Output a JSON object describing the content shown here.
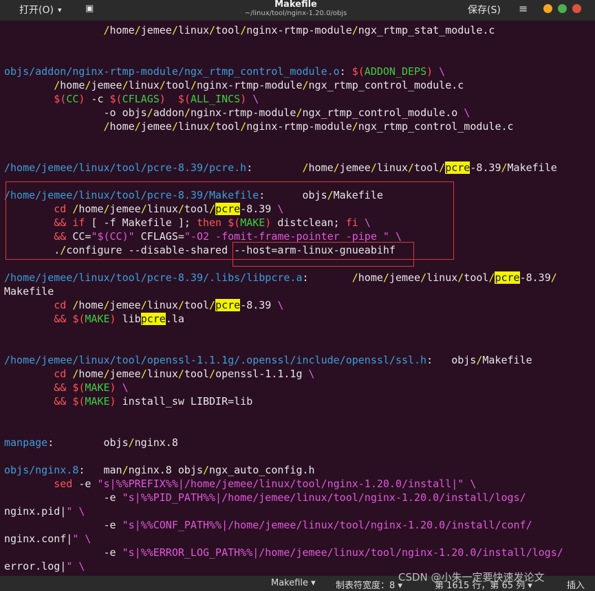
{
  "header": {
    "open_label": "打开(O)",
    "title": "Makefile",
    "path": "~/linux/tool/nginx-1.20.0/objs",
    "save_label": "保存(S)"
  },
  "status": {
    "language": "Makefile",
    "tab_width": "制表符宽度：8",
    "position": "第 1615 行，第 65 列",
    "mode": "插入"
  },
  "watermark": "CSDN @小朱一定要快速发论文",
  "code_lines": [
    {
      "t": "                /home/jemee/linux/tool/nginx-rtmp-module/ngx_rtmp_stat_module.c"
    },
    {
      "t": ""
    },
    {
      "t": ""
    },
    {
      "t": "objs/addon/nginx-rtmp-module/ngx_rtmp_control_module.o: $(ADDON_DEPS) \\"
    },
    {
      "t": "        /home/jemee/linux/tool/nginx-rtmp-module/ngx_rtmp_control_module.c"
    },
    {
      "t": "        $(CC) -c $(CFLAGS)  $(ALL_INCS) \\"
    },
    {
      "t": "                -o objs/addon/nginx-rtmp-module/ngx_rtmp_control_module.o \\"
    },
    {
      "t": "                /home/jemee/linux/tool/nginx-rtmp-module/ngx_rtmp_control_module.c"
    },
    {
      "t": ""
    },
    {
      "t": ""
    },
    {
      "t": "/home/jemee/linux/tool/pcre-8.39/pcre.h:        /home/jemee/linux/tool/pcre-8.39/Makefile"
    },
    {
      "t": ""
    },
    {
      "t": "/home/jemee/linux/tool/pcre-8.39/Makefile:      objs/Makefile"
    },
    {
      "t": "        cd /home/jemee/linux/tool/pcre-8.39 \\"
    },
    {
      "t": "        && if [ -f Makefile ]; then $(MAKE) distclean; fi \\"
    },
    {
      "t": "        && CC=\"$(CC)\" CFLAGS=\"-O2 -fomit-frame-pointer -pipe \" \\"
    },
    {
      "t": "        ./configure --disable-shared --host=arm-linux-gnueabihf"
    },
    {
      "t": ""
    },
    {
      "t": "/home/jemee/linux/tool/pcre-8.39/.libs/libpcre.a:       /home/jemee/linux/tool/pcre-8.39/"
    },
    {
      "t": "Makefile"
    },
    {
      "t": "        cd /home/jemee/linux/tool/pcre-8.39 \\"
    },
    {
      "t": "        && $(MAKE) libpcre.la"
    },
    {
      "t": ""
    },
    {
      "t": ""
    },
    {
      "t": "/home/jemee/linux/tool/openssl-1.1.1g/.openssl/include/openssl/ssl.h:   objs/Makefile"
    },
    {
      "t": "        cd /home/jemee/linux/tool/openssl-1.1.1g \\"
    },
    {
      "t": "        && $(MAKE) \\"
    },
    {
      "t": "        && $(MAKE) install_sw LIBDIR=lib"
    },
    {
      "t": ""
    },
    {
      "t": ""
    },
    {
      "t": "manpage:        objs/nginx.8"
    },
    {
      "t": ""
    },
    {
      "t": "objs/nginx.8:   man/nginx.8 objs/ngx_auto_config.h"
    },
    {
      "t": "        sed -e \"s|%%PREFIX%%|/home/jemee/linux/tool/nginx-1.20.0/install|\" \\"
    },
    {
      "t": "                -e \"s|%%PID_PATH%%|/home/jemee/linux/tool/nginx-1.20.0/install/logs/"
    },
    {
      "t": "nginx.pid|\" \\"
    },
    {
      "t": "                -e \"s|%%CONF_PATH%%|/home/jemee/linux/tool/nginx-1.20.0/install/conf/"
    },
    {
      "t": "nginx.conf|\" \\"
    },
    {
      "t": "                -e \"s|%%ERROR_LOG_PATH%%|/home/jemee/linux/tool/nginx-1.20.0/install/logs/"
    },
    {
      "t": "error.log|\" \\"
    }
  ]
}
